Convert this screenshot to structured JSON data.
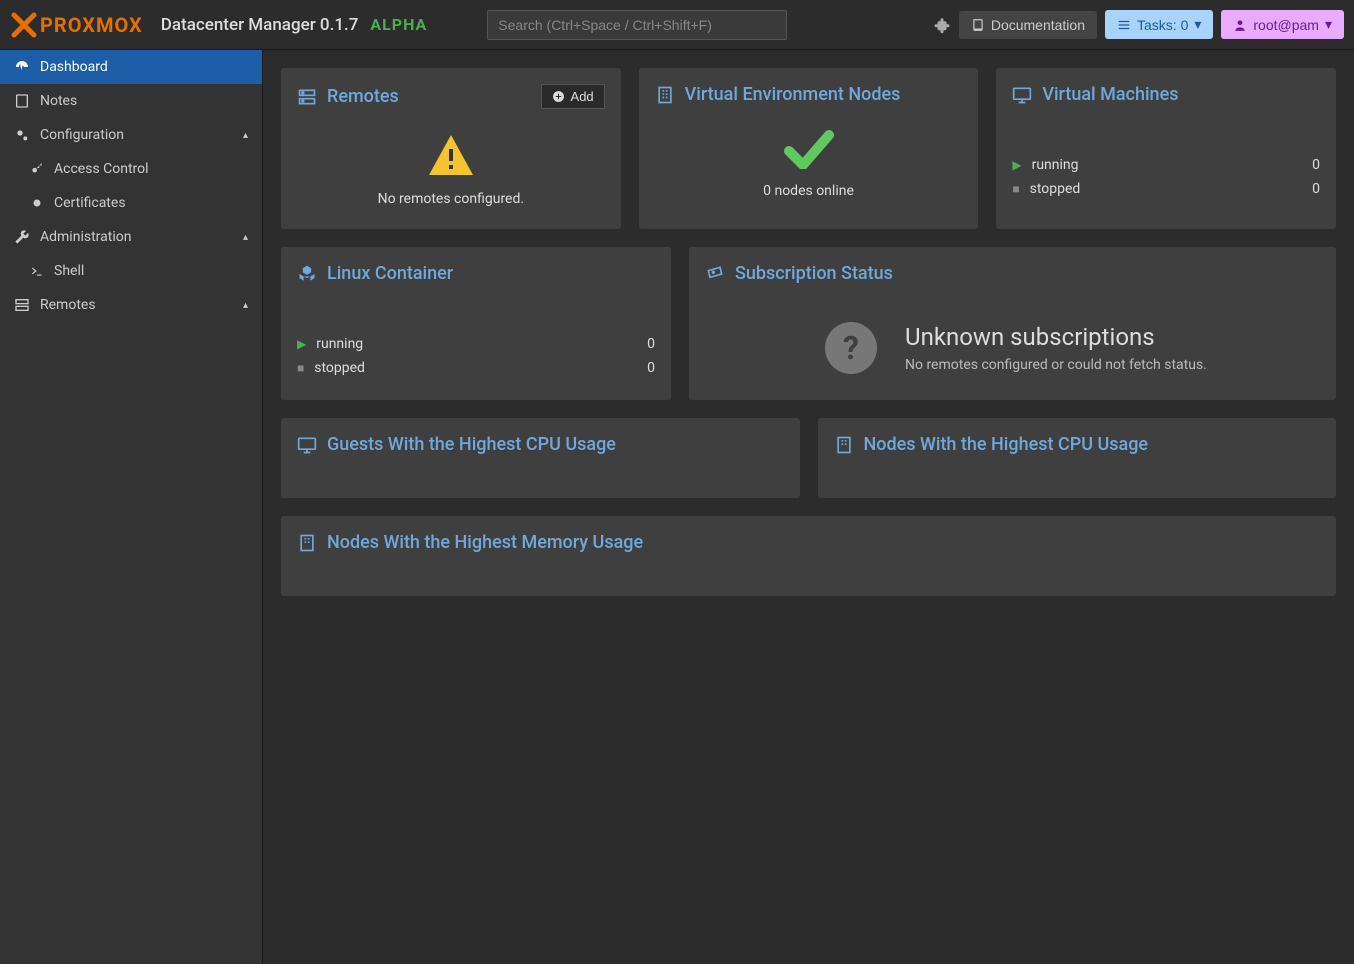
{
  "header": {
    "logo_text": "PROXMOX",
    "app_title": "Datacenter Manager 0.1.7",
    "alpha": "ALPHA",
    "search_placeholder": "Search (Ctrl+Space / Ctrl+Shift+F)",
    "doc_label": "Documentation",
    "tasks_label": "Tasks: 0",
    "user_label": "root@pam"
  },
  "sidebar": {
    "dashboard": "Dashboard",
    "notes": "Notes",
    "configuration": "Configuration",
    "access_control": "Access Control",
    "certificates": "Certificates",
    "administration": "Administration",
    "shell": "Shell",
    "remotes": "Remotes"
  },
  "cards": {
    "remotes": {
      "title": "Remotes",
      "add": "Add",
      "empty": "No remotes configured."
    },
    "ven": {
      "title": "Virtual Environment Nodes",
      "status": "0 nodes online"
    },
    "vm": {
      "title": "Virtual Machines",
      "running_label": "running",
      "running_count": "0",
      "stopped_label": "stopped",
      "stopped_count": "0"
    },
    "lxc": {
      "title": "Linux Container",
      "running_label": "running",
      "running_count": "0",
      "stopped_label": "stopped",
      "stopped_count": "0"
    },
    "subscription": {
      "title": "Subscription Status",
      "heading": "Unknown subscriptions",
      "detail": "No remotes configured or could not fetch status."
    },
    "guest_cpu": {
      "title": "Guests With the Highest CPU Usage"
    },
    "node_cpu": {
      "title": "Nodes With the Highest CPU Usage"
    },
    "node_mem": {
      "title": "Nodes With the Highest Memory Usage"
    }
  }
}
